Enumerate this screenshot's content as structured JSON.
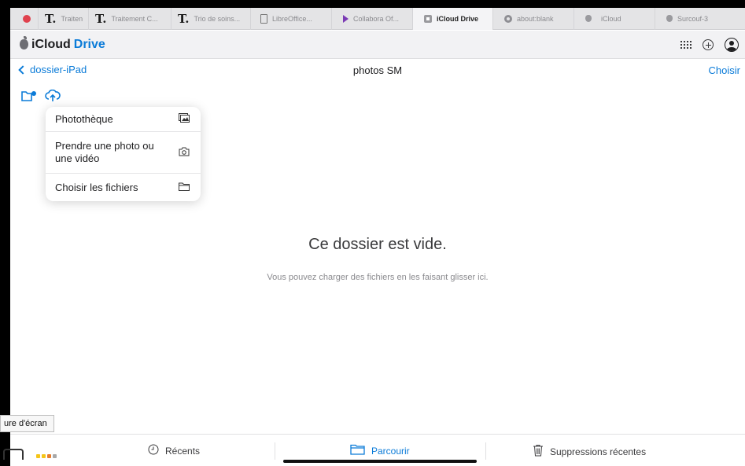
{
  "browser_tabs": [
    {
      "label": "",
      "icon": "red-circle-icon"
    },
    {
      "label": "Traiten",
      "icon": "t-letter-icon"
    },
    {
      "label": "Traitement C...",
      "icon": "t-letter-icon"
    },
    {
      "label": "Trio de soins...",
      "icon": "t-letter-icon"
    },
    {
      "label": "LibreOffice...",
      "icon": "document-icon"
    },
    {
      "label": "Collabora Of...",
      "icon": "arrow-icon"
    },
    {
      "label": "iCloud Drive",
      "icon": "box-icon",
      "active": true
    },
    {
      "label": "about:blank",
      "icon": "compass-icon"
    },
    {
      "label": "iCloud",
      "icon": "apple-icon"
    },
    {
      "label": "Surcouf-3",
      "icon": "apple-icon"
    }
  ],
  "header": {
    "brand_prefix": "iCloud",
    "brand_accent": "Drive"
  },
  "nav": {
    "back_label": "dossier-iPad",
    "title": "photos SM",
    "choose_label": "Choisir"
  },
  "upload_menu": {
    "items": [
      {
        "label": "Photothèque",
        "icon": "photo-library-icon"
      },
      {
        "label": "Prendre une photo ou une vidéo",
        "icon": "camera-icon"
      },
      {
        "label": "Choisir les fichiers",
        "icon": "folder-icon"
      }
    ]
  },
  "empty_state": {
    "title": "Ce dossier est vide.",
    "subtitle": "Vous pouvez charger des fichiers en les faisant glisser ici."
  },
  "tooltip": {
    "text": "ure d'écran"
  },
  "bottom_tabs": [
    {
      "label": "Récents",
      "icon": "clock-icon"
    },
    {
      "label": "Parcourir",
      "icon": "folder-icon",
      "active": true
    },
    {
      "label": "Suppressions récentes",
      "icon": "trash-icon"
    }
  ],
  "colors": {
    "accent": "#0a7bd8",
    "background": "#ffffff",
    "tab_bar": "#e4e4e6"
  }
}
